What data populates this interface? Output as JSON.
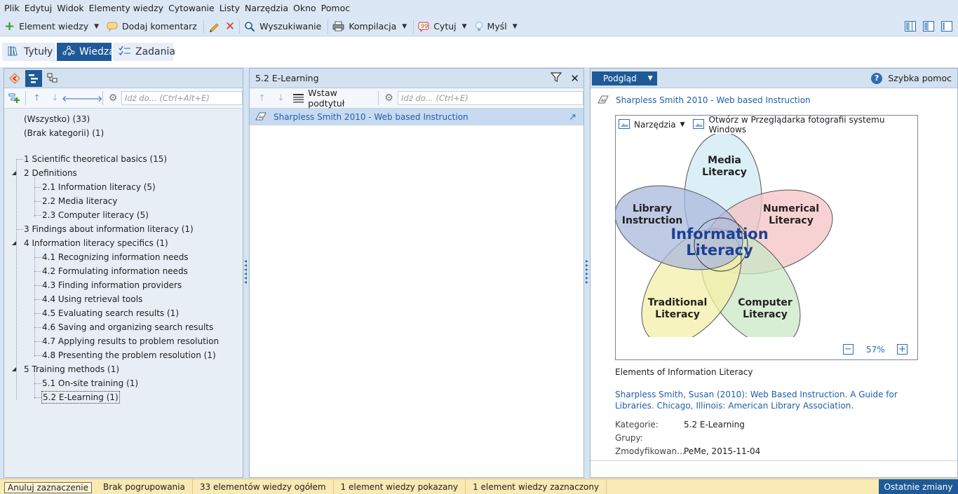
{
  "menu": [
    "Plik",
    "Edytuj",
    "Widok",
    "Elementy wiedzy",
    "Cytowanie",
    "Listy",
    "Narzędzia",
    "Okno",
    "Pomoc"
  ],
  "toolbar": {
    "new_item": "Element wiedzy",
    "add_comment": "Dodaj komentarz",
    "search": "Wyszukiwanie",
    "compile": "Kompilacja",
    "cite": "Cytuj",
    "thought": "Myśl"
  },
  "modes": [
    "Tytuły",
    "Wiedza",
    "Zadania"
  ],
  "left": {
    "search_placeholder": "Idź do... (Ctrl+Alt+E)",
    "special": [
      "(Wszystko) (33)",
      "(Brak kategorii) (1)"
    ],
    "tree": [
      {
        "label": "1 Scientific theoretical basics (15)",
        "level": 0,
        "expanded": null
      },
      {
        "label": "2 Definitions",
        "level": 0,
        "expanded": true
      },
      {
        "label": "2.1 Information literacy (5)",
        "level": 1
      },
      {
        "label": "2.2 Media literacy",
        "level": 1
      },
      {
        "label": "2.3 Computer literacy (5)",
        "level": 1
      },
      {
        "label": "3 Findings about information literacy (1)",
        "level": 0,
        "expanded": null
      },
      {
        "label": "4 Information literacy specifics (1)",
        "level": 0,
        "expanded": true
      },
      {
        "label": "4.1 Recognizing information needs",
        "level": 1
      },
      {
        "label": "4.2 Formulating information needs",
        "level": 1
      },
      {
        "label": "4.3 Finding information providers",
        "level": 1
      },
      {
        "label": "4.4 Using retrieval tools",
        "level": 1
      },
      {
        "label": "4.5 Evaluating search results (1)",
        "level": 1
      },
      {
        "label": "4.6 Saving and organizing search results",
        "level": 1
      },
      {
        "label": "4.7 Applying results to problem resolution",
        "level": 1
      },
      {
        "label": "4.8 Presenting the problem resolution (1)",
        "level": 1
      },
      {
        "label": "5 Training methods (1)",
        "level": 0,
        "expanded": true
      },
      {
        "label": "5.1 On-site training (1)",
        "level": 1
      },
      {
        "label": "5.2 E-Learning (1)",
        "level": 1,
        "selected": true
      }
    ]
  },
  "mid": {
    "title": "5.2 E-Learning",
    "insert_subtitle": "Wstaw podtytuł",
    "search_placeholder": "Idź do... (Ctrl+E)",
    "items": [
      "Sharpless Smith 2010 - Web based Instruction"
    ]
  },
  "right": {
    "preview_label": "Podgląd",
    "quick_help": "Szybka pomoc",
    "item_title": "Sharpless Smith 2010 - Web based Instruction",
    "image_tools": "Narzędzia",
    "open_in": "Otwórz w Przeglądarka fotografii systemu Windows",
    "zoom": "57%",
    "diagram": {
      "center": [
        "Information",
        "Literacy"
      ],
      "petals": [
        {
          "label": [
            "Media",
            "Literacy"
          ],
          "color": "#cfeaf4"
        },
        {
          "label": [
            "Numerical",
            "Literacy"
          ],
          "color": "#f6c3c3"
        },
        {
          "label": [
            "Computer",
            "Literacy"
          ],
          "color": "#c9e7c6"
        },
        {
          "label": [
            "Traditional",
            "Literacy"
          ],
          "color": "#f4efa8"
        },
        {
          "label": [
            "Library",
            "Instruction"
          ],
          "color": "#a9b8dc"
        }
      ]
    },
    "caption": "Elements of Information Literacy",
    "reference": "Sharpless Smith, Susan (2010): Web Based Instruction. A Guide for Libraries. Chicago, Illinois: American Library Association.",
    "meta": [
      {
        "key": "Kategorie:",
        "value": "5.2 E-Learning"
      },
      {
        "key": "Grupy:",
        "value": ""
      },
      {
        "key": "Zmodyfikowan...",
        "value": "PeMe, 2015-11-04"
      }
    ]
  },
  "status": {
    "clear_selection": "Anuluj zaznaczenie",
    "grouping": "Brak pogrupowania",
    "total": "33 elementów wiedzy ogółem",
    "shown": "1 element wiedzy pokazany",
    "selected": "1 element wiedzy zaznaczony",
    "recent": "Ostatnie zmiany"
  },
  "colors": {
    "accent": "#1e5a97",
    "link": "#1f5fa6",
    "status_bg": "#f9e9b4",
    "center_text": "#1d3f96"
  }
}
